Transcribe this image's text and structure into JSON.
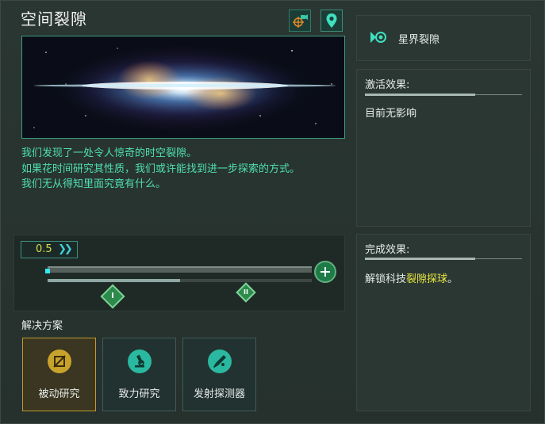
{
  "title": "空间裂隙",
  "header_buttons": [
    {
      "icon": "camera-target-icon"
    },
    {
      "icon": "map-pin-icon"
    }
  ],
  "description": [
    "我们发现了一处令人惊奇的时空裂隙。",
    "如果花时间研究其性质，我们或许能找到进一步探索的方式。",
    "我们无从得知里面究竟有什么。"
  ],
  "progress": {
    "speed": "0.5",
    "speed_icon": "fast-forward-icon",
    "progress_fraction": 0.5,
    "markers": [
      "I",
      "II"
    ],
    "add_icon": "plus-icon"
  },
  "solutions": {
    "title": "解决方案",
    "items": [
      {
        "label": "被动研究",
        "icon": "passive-research-icon",
        "selected": true
      },
      {
        "label": "致力研究",
        "icon": "microscope-icon",
        "selected": false
      },
      {
        "label": "发射探测器",
        "icon": "probe-launch-icon",
        "selected": false
      }
    ]
  },
  "location": {
    "icon": "system-icon",
    "name": "星界裂隙"
  },
  "activation": {
    "heading": "激活效果:",
    "body": "目前无影响"
  },
  "completion": {
    "heading": "完成效果:",
    "prefix": "解锁科技",
    "highlight": "裂隙探球",
    "suffix": "。"
  },
  "colors": {
    "accent": "#4fdfb2",
    "highlight": "#e8e642",
    "selected_border": "#c29a2c"
  }
}
